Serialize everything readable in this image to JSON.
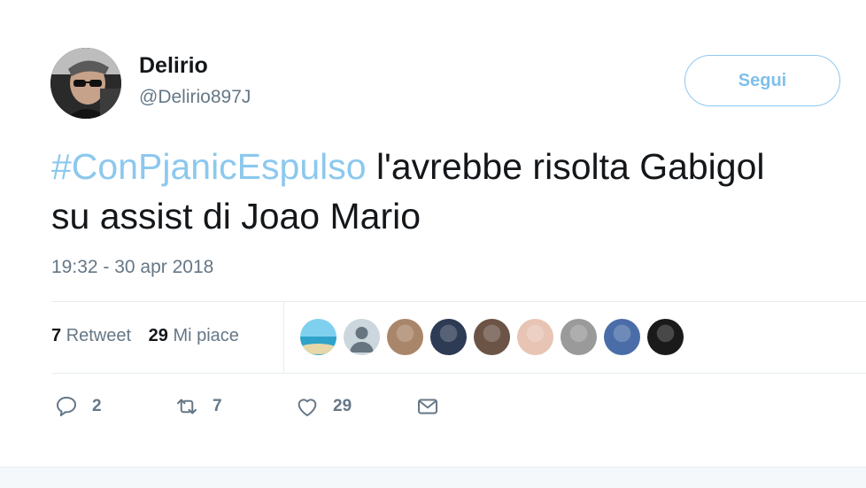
{
  "author": {
    "display_name": "Delirio",
    "handle": "@Delirio897J"
  },
  "follow_button": {
    "label": "Segui"
  },
  "tweet": {
    "hashtag": "#ConPjanicEspulso",
    "text_line1_rest": " l'avrebbe risolta Gabigol",
    "text_line2": "su assist di Joao Mario",
    "timestamp": "19:32 - 30 apr 2018"
  },
  "stats": {
    "retweets_count": "7",
    "retweets_label": "Retweet",
    "likes_count": "29",
    "likes_label": "Mi piace"
  },
  "likers": [
    {
      "name": "liker-avatar-beach",
      "color": "#5fb3d9"
    },
    {
      "name": "liker-avatar-default",
      "color": "#ccd6dd"
    },
    {
      "name": "liker-avatar-3",
      "color": "#a9866a"
    },
    {
      "name": "liker-avatar-4",
      "color": "#2d3b55"
    },
    {
      "name": "liker-avatar-5",
      "color": "#6b5346"
    },
    {
      "name": "liker-avatar-6",
      "color": "#e8c4b4"
    },
    {
      "name": "liker-avatar-7",
      "color": "#9a9a9a"
    },
    {
      "name": "liker-avatar-8",
      "color": "#4a6da8"
    },
    {
      "name": "liker-avatar-9",
      "color": "#1a1a1a"
    }
  ],
  "actions": {
    "reply_count": "2",
    "retweet_count": "7",
    "like_count": "29"
  },
  "colors": {
    "accent": "#1da1f2",
    "hashtag": "#8cc8ee",
    "muted_text": "#657786"
  }
}
